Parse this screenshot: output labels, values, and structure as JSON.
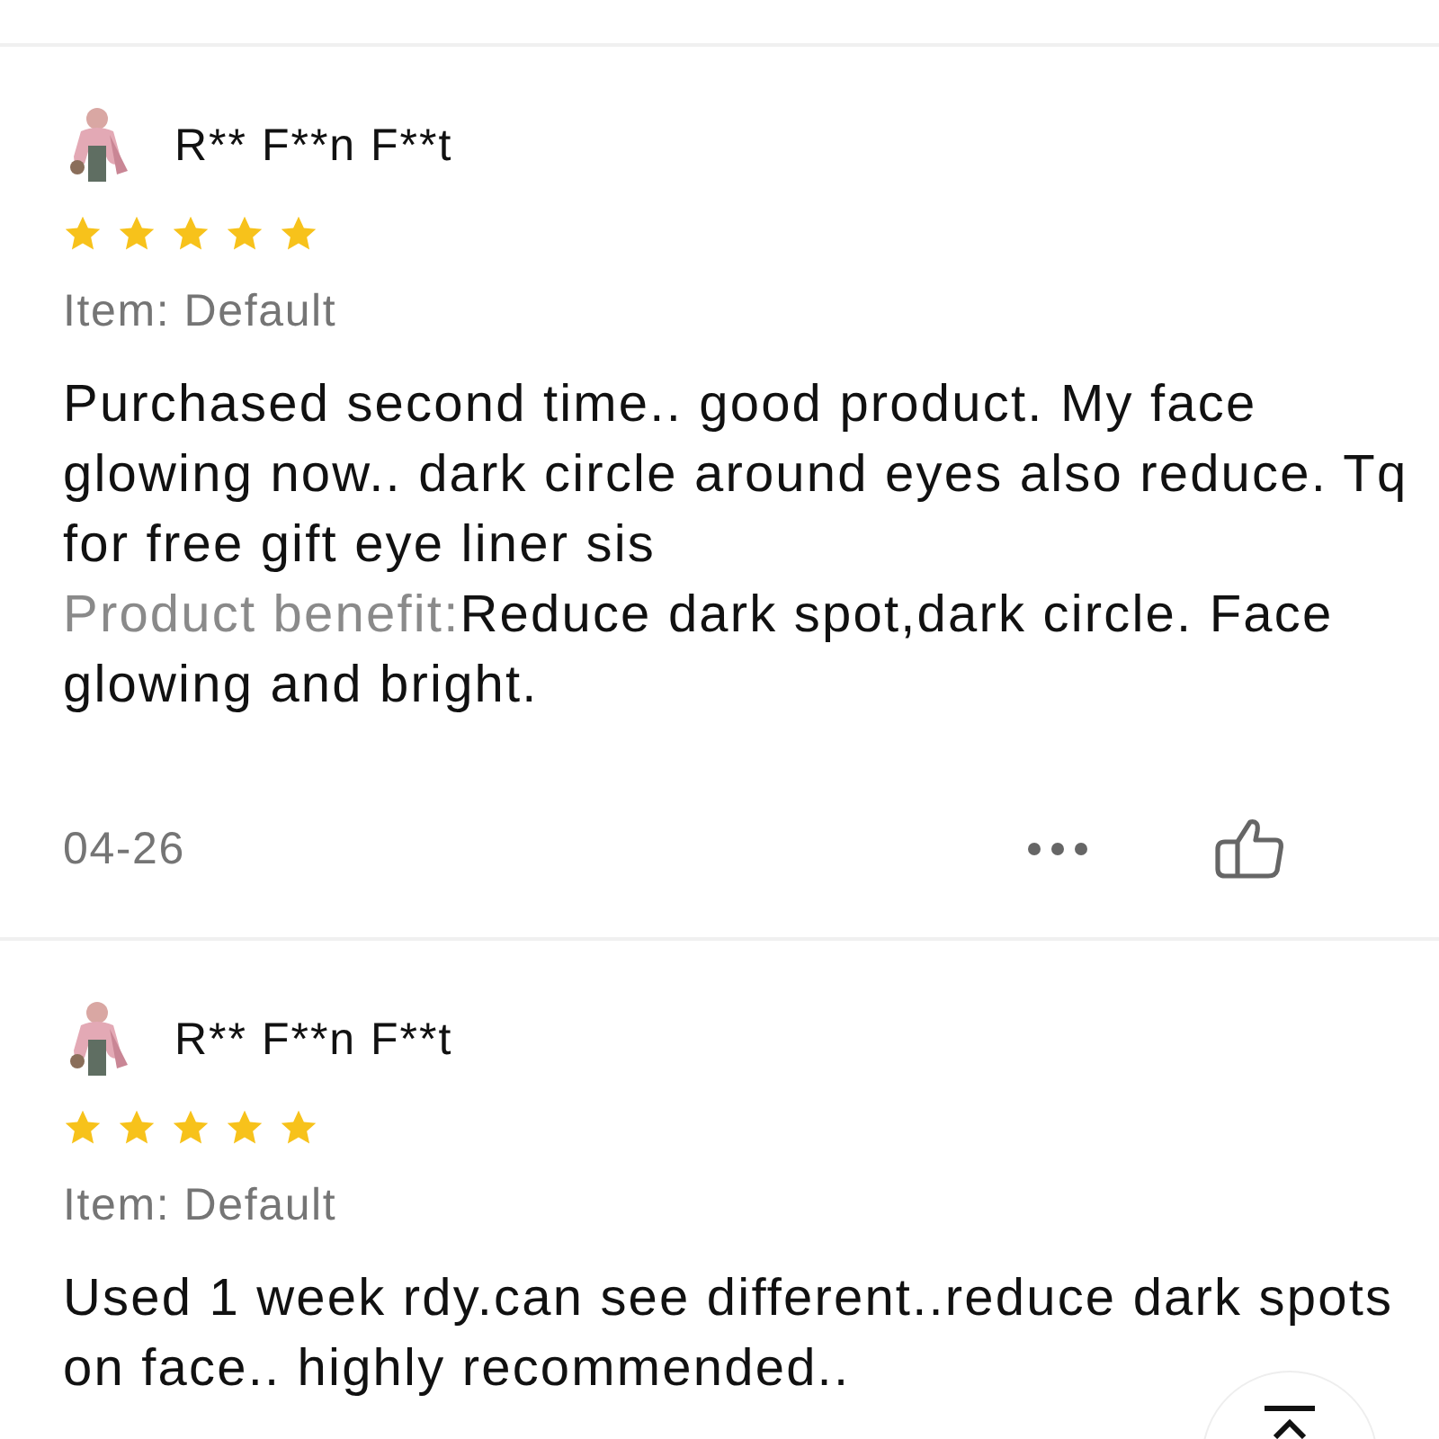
{
  "reviews": [
    {
      "name": "R** F**n F**t",
      "stars": 5,
      "item": "Item: Default",
      "text": "Purchased second time.. good product. My face glowing now.. dark circle around eyes also reduce. Tq for free gift eye liner sis",
      "benefit_label": "Product benefit:",
      "benefit_value": "Reduce dark spot,dark circle. Face glowing and bright.",
      "date": "04-26"
    },
    {
      "name": "R** F**n F**t",
      "stars": 5,
      "item": "Item: Default",
      "text": "Used 1 week rdy.can see different..reduce dark spots on face.. highly recommended.."
    }
  ]
}
